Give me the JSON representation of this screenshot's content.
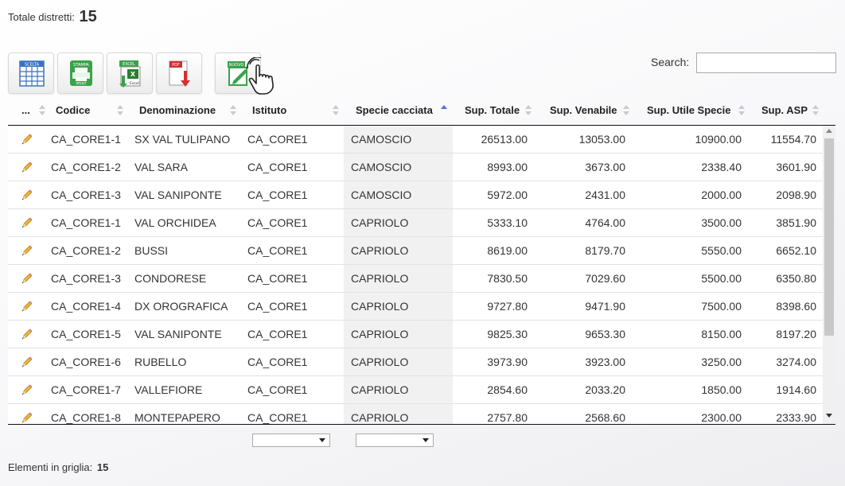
{
  "header": {
    "total_label": "Totale distretti:",
    "total_value": "15"
  },
  "toolbar": {
    "buttons": [
      {
        "name": "scelta",
        "label": "SCELTA"
      },
      {
        "name": "stampa",
        "label": "STAMPA",
        "sublabel": "PRINT"
      },
      {
        "name": "excel",
        "label": "EXCEL",
        "sublabel": "Excel"
      },
      {
        "name": "pdf",
        "label": "PDF"
      },
      {
        "name": "nuovo",
        "label": "NUOVO"
      }
    ]
  },
  "search": {
    "label": "Search:",
    "value": ""
  },
  "table": {
    "columns": [
      "...",
      "Codice",
      "Denominazione",
      "Istituto",
      "Specie cacciata",
      "Sup. Totale",
      "Sup. Venabile",
      "Sup. Utile Specie",
      "Sup. ASP"
    ],
    "sorted_column": "Specie cacciata",
    "rows": [
      [
        "CA_CORE1-1",
        "SX VAL TULIPANO",
        "CA_CORE1",
        "CAMOSCIO",
        "26513.00",
        "13053.00",
        "10900.00",
        "11554.70"
      ],
      [
        "CA_CORE1-2",
        "VAL SARA",
        "CA_CORE1",
        "CAMOSCIO",
        "8993.00",
        "3673.00",
        "2338.40",
        "3601.90"
      ],
      [
        "CA_CORE1-3",
        "VAL SANIPONTE",
        "CA_CORE1",
        "CAMOSCIO",
        "5972.00",
        "2431.00",
        "2000.00",
        "2098.90"
      ],
      [
        "CA_CORE1-1",
        "VAL ORCHIDEA",
        "CA_CORE1",
        "CAPRIOLO",
        "5333.10",
        "4764.00",
        "3500.00",
        "3851.90"
      ],
      [
        "CA_CORE1-2",
        "BUSSI",
        "CA_CORE1",
        "CAPRIOLO",
        "8619.00",
        "8179.70",
        "5550.00",
        "6652.10"
      ],
      [
        "CA_CORE1-3",
        "CONDORESE",
        "CA_CORE1",
        "CAPRIOLO",
        "7830.50",
        "7029.60",
        "5500.00",
        "6350.80"
      ],
      [
        "CA_CORE1-4",
        "DX OROGRAFICA",
        "CA_CORE1",
        "CAPRIOLO",
        "9727.80",
        "9471.90",
        "7500.00",
        "8398.60"
      ],
      [
        "CA_CORE1-5",
        "VAL SANIPONTE",
        "CA_CORE1",
        "CAPRIOLO",
        "9825.30",
        "9653.30",
        "8150.00",
        "8197.20"
      ],
      [
        "CA_CORE1-6",
        "RUBELLO",
        "CA_CORE1",
        "CAPRIOLO",
        "3973.90",
        "3923.00",
        "3250.00",
        "3274.00"
      ],
      [
        "CA_CORE1-7",
        "VALLEFIORE",
        "CA_CORE1",
        "CAPRIOLO",
        "2854.60",
        "2033.20",
        "1850.00",
        "1914.60"
      ],
      [
        "CA_CORE1-8",
        "MONTEPAPERO",
        "CA_CORE1",
        "CAPRIOLO",
        "2757.80",
        "2568.60",
        "2300.00",
        "2333.90"
      ]
    ]
  },
  "filters": {
    "istituto_value": "",
    "specie_value": ""
  },
  "footer": {
    "label": "Elementi in griglia:",
    "value": "15"
  }
}
